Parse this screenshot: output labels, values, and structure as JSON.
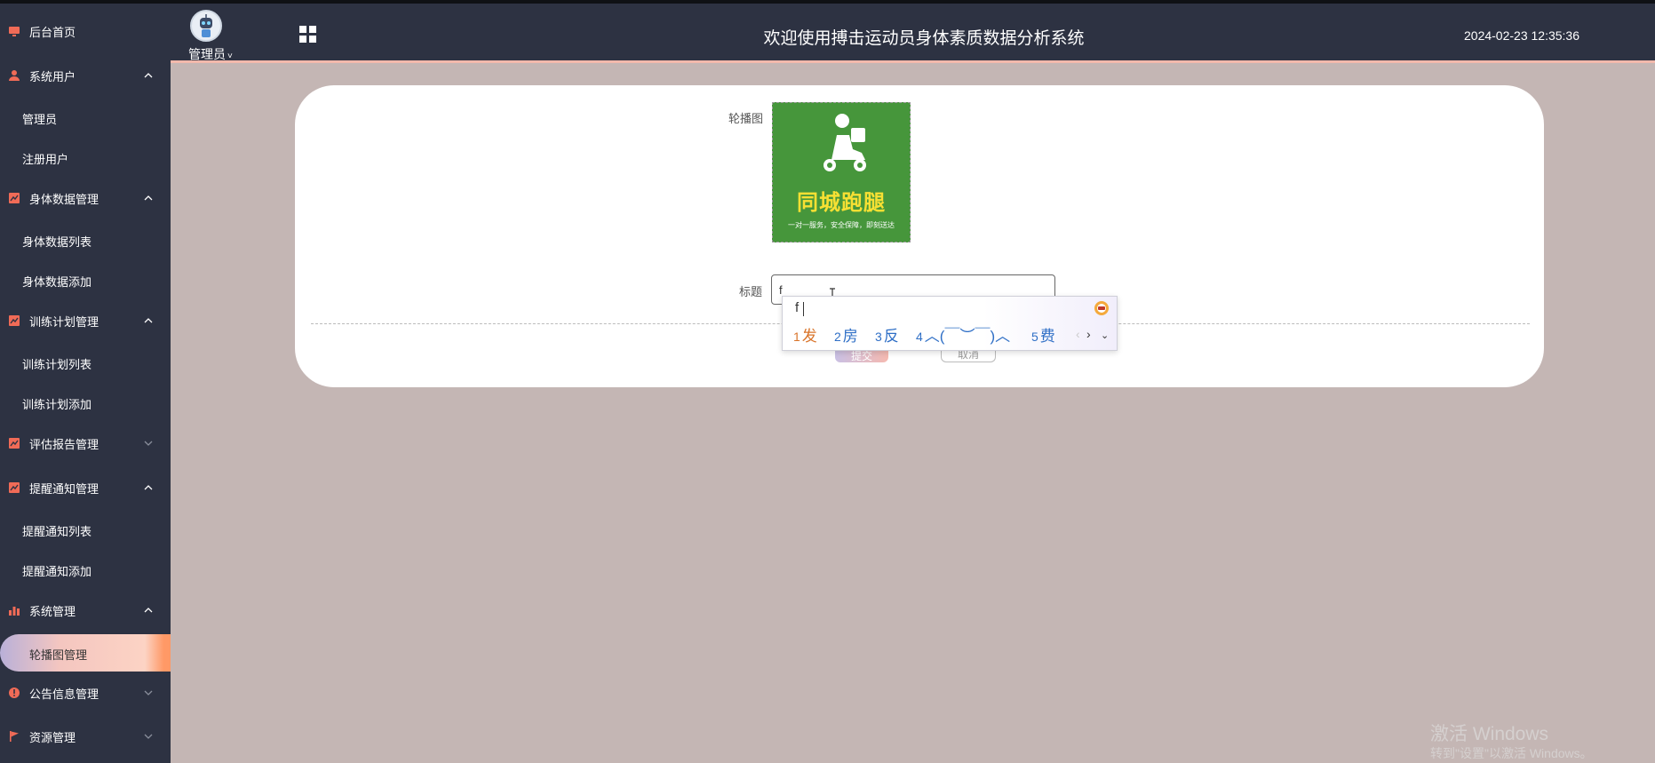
{
  "header": {
    "title": "欢迎使用搏击运动员身体素质数据分析系统",
    "datetime": "2024-02-23 12:35:36",
    "user": "管理员"
  },
  "sidebar": {
    "items": [
      {
        "label": "后台首页",
        "icon": "monitor-icon",
        "type": "top"
      },
      {
        "label": "系统用户",
        "icon": "user-icon",
        "type": "group",
        "expanded": true
      },
      {
        "label": "管理员",
        "type": "sub"
      },
      {
        "label": "注册用户",
        "type": "sub"
      },
      {
        "label": "身体数据管理",
        "icon": "chart-icon",
        "type": "group",
        "expanded": true
      },
      {
        "label": "身体数据列表",
        "type": "sub"
      },
      {
        "label": "身体数据添加",
        "type": "sub"
      },
      {
        "label": "训练计划管理",
        "icon": "chart-icon",
        "type": "group",
        "expanded": true
      },
      {
        "label": "训练计划列表",
        "type": "sub"
      },
      {
        "label": "训练计划添加",
        "type": "sub"
      },
      {
        "label": "评估报告管理",
        "icon": "chart-icon",
        "type": "group",
        "expanded": false
      },
      {
        "label": "提醒通知管理",
        "icon": "chart-icon",
        "type": "group",
        "expanded": true
      },
      {
        "label": "提醒通知列表",
        "type": "sub"
      },
      {
        "label": "提醒通知添加",
        "type": "sub"
      },
      {
        "label": "系统管理",
        "icon": "bar-chart-icon",
        "type": "group",
        "expanded": true
      },
      {
        "label": "轮播图管理",
        "type": "sub",
        "active": true
      },
      {
        "label": "公告信息管理",
        "icon": "info-icon",
        "type": "group",
        "expanded": false
      },
      {
        "label": "资源管理",
        "icon": "flag-icon",
        "type": "group",
        "expanded": false
      }
    ]
  },
  "form": {
    "image_label": "轮播图",
    "title_label": "标题",
    "title_value": "f",
    "image": {
      "logo_text": "同城跑腿",
      "slogan": "一对一服务，安全保障，即刻送达"
    },
    "submit_label": "提交",
    "cancel_label": "取消"
  },
  "ime": {
    "composition": "f",
    "candidates": [
      {
        "num": "1",
        "text": "发"
      },
      {
        "num": "2",
        "text": "房"
      },
      {
        "num": "3",
        "text": "反"
      },
      {
        "num": "4",
        "text": "︿(￣︶￣)︿"
      },
      {
        "num": "5",
        "text": "费"
      }
    ]
  },
  "watermark": {
    "line1": "激活 Windows",
    "line2": "转到\"设置\"以激活 Windows。"
  },
  "colors": {
    "sidebar_bg": "#2d3242",
    "content_bg": "#c4b6b4",
    "accent_icon": "#f06b57",
    "active_accent": "#ff9966"
  }
}
